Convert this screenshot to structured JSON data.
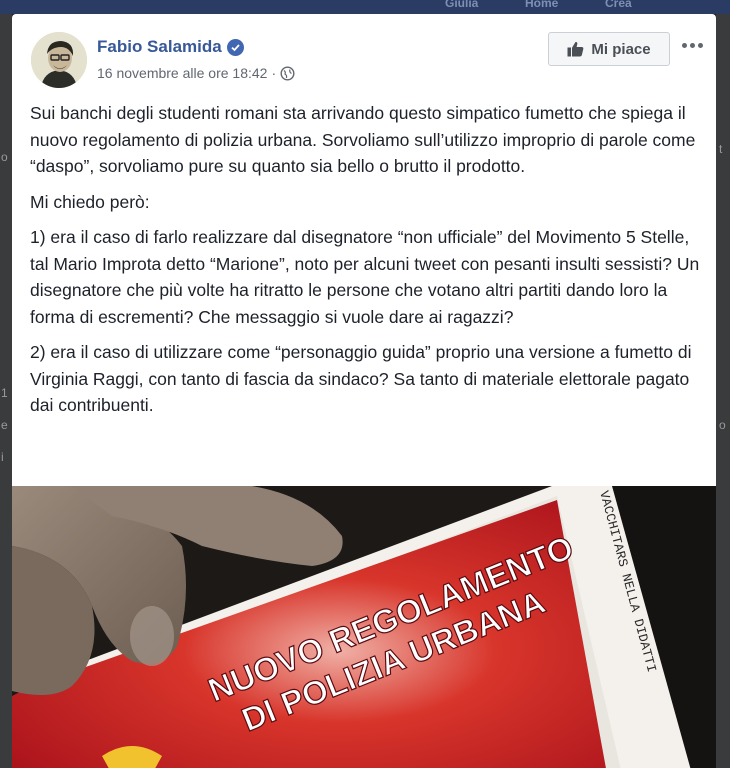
{
  "background": {
    "topbar_ghosts": [
      "Giulia",
      "Home",
      "Crea"
    ],
    "left_fragments": [
      "o",
      "1",
      "e",
      "i"
    ],
    "right_fragments": [
      "t",
      "o"
    ]
  },
  "post": {
    "author": "Fabio Salamida",
    "date": "16 novembre alle ore 18:42",
    "separator": "·",
    "like_button_label": "Mi piace",
    "paragraphs": [
      "Sui banchi degli studenti romani sta arrivando questo simpatico fumetto che spiega il nuovo regolamento di polizia urbana. Sorvoliamo sull’utilizzo improprio di parole come “daspo”, sorvoliamo pure su quanto sia bello o brutto il prodotto.",
      "Mi chiedo però:",
      "1) era il caso di farlo realizzare dal disegnatore “non ufficiale” del Movimento 5 Stelle, tal Mario Improta detto “Marione”, noto per alcuni tweet con pesanti insulti sessisti? Un disegnatore che più volte ha ritratto le persone che votano altri partiti dando loro la forma di escrementi? Che messaggio si vuole dare ai ragazzi?",
      "2) era il caso di utilizzare come “personaggio guida” proprio una versione a fumetto di Virginia Raggi, con tanto di fascia da sindaco? Sa tanto di materiale elettorale pagato dai contribuenti."
    ],
    "photo": {
      "title_line1": "NUOVO REGOLAMENTO",
      "title_line2": "DI POLIZIA URBANA",
      "handwriting": "VACCHITARS NELLA DIDATTI"
    }
  },
  "colors": {
    "author": "#385898",
    "text": "#1d2129",
    "meta": "#616770",
    "verified": "#4267b2",
    "booklet_red": "#c8102e"
  },
  "icons": [
    "verified-badge-icon",
    "globe-icon",
    "thumbs-up-icon",
    "more-options-icon"
  ]
}
